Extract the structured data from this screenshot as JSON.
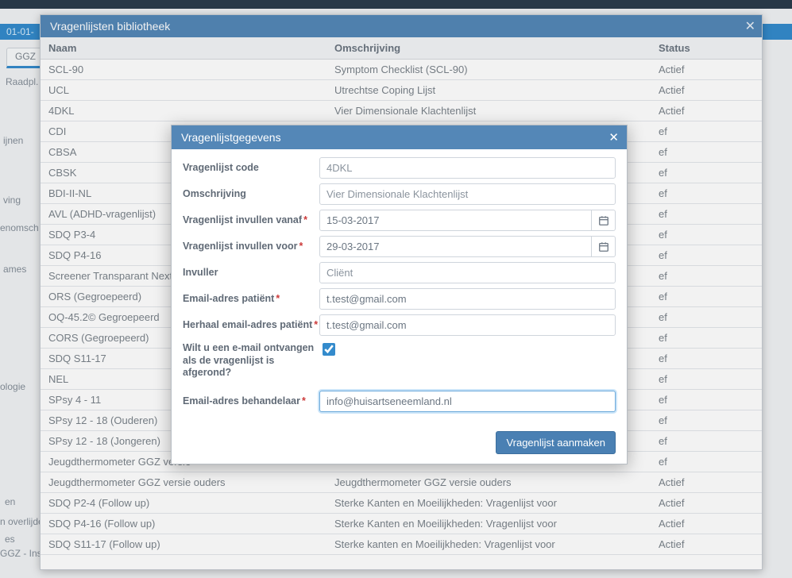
{
  "bg": {
    "date": "01-01-",
    "tab": "GGZ",
    "raadpl": "Raadpl. h",
    "frag1": "ijnen",
    "frag2": "ving",
    "frag3": "enomsch",
    "frag4": "ames",
    "frag5": "ologie",
    "frag6": "en",
    "frag7": "n overlijde",
    "frag8": "es",
    "frag9": "GGZ - Ins"
  },
  "library": {
    "title": "Vragenlijsten bibliotheek",
    "cols": {
      "name": "Naam",
      "desc": "Omschrijving",
      "status": "Status"
    },
    "rows": [
      {
        "name": "SCL-90",
        "desc": "Symptom Checklist (SCL-90)",
        "status": "Actief"
      },
      {
        "name": "UCL",
        "desc": "Utrechtse Coping Lijst",
        "status": "Actief"
      },
      {
        "name": "4DKL",
        "desc": "Vier Dimensionale Klachtenlijst",
        "status": "Actief"
      },
      {
        "name": "CDI",
        "desc": "",
        "status": "ef"
      },
      {
        "name": "CBSA",
        "desc": "",
        "status": "ef"
      },
      {
        "name": "CBSK",
        "desc": "",
        "status": "ef"
      },
      {
        "name": "BDI-II-NL",
        "desc": "",
        "status": "ef"
      },
      {
        "name": "AVL (ADHD-vragenlijst)",
        "desc": "",
        "status": "ef"
      },
      {
        "name": "SDQ P3-4",
        "desc": "",
        "status": "ef"
      },
      {
        "name": "SDQ P4-16",
        "desc": "",
        "status": "ef"
      },
      {
        "name": "Screener Transparant Next",
        "desc": "",
        "status": "ef"
      },
      {
        "name": "ORS (Gegroepeerd)",
        "desc": "",
        "status": "ef"
      },
      {
        "name": "OQ-45.2© Gegroepeerd",
        "desc": "",
        "status": "ef"
      },
      {
        "name": "CORS (Gegroepeerd)",
        "desc": "",
        "status": "ef"
      },
      {
        "name": "SDQ S11-17",
        "desc": "",
        "status": "ef"
      },
      {
        "name": "NEL",
        "desc": "",
        "status": "ef"
      },
      {
        "name": "SPsy 4 - 11",
        "desc": "",
        "status": "ef"
      },
      {
        "name": "SPsy 12 - 18 (Ouderen)",
        "desc": "",
        "status": "ef"
      },
      {
        "name": "SPsy 12 - 18 (Jongeren)",
        "desc": "",
        "status": "ef"
      },
      {
        "name": "Jeugdthermometer GGZ versie",
        "desc": "",
        "status": "ef"
      },
      {
        "name": "Jeugdthermometer GGZ versie ouders",
        "desc": "Jeugdthermometer GGZ versie ouders",
        "status": "Actief"
      },
      {
        "name": "SDQ P2-4 (Follow up)",
        "desc": "Sterke Kanten en Moeilijkheden: Vragenlijst voor",
        "status": "Actief"
      },
      {
        "name": "SDQ P4-16 (Follow up)",
        "desc": "Sterke Kanten en Moeilijkheden: Vragenlijst voor",
        "status": "Actief"
      },
      {
        "name": "SDQ S11-17 (Follow up)",
        "desc": "Sterke kanten en Moeilijkheden: Vragenlijst voor",
        "status": "Actief"
      }
    ]
  },
  "form": {
    "title": "Vragenlijstgegevens",
    "labels": {
      "code": "Vragenlijst code",
      "desc": "Omschrijving",
      "from": "Vragenlijst invullen vanaf",
      "to": "Vragenlijst invullen voor",
      "filler": "Invuller",
      "email": "Email-adres patiënt",
      "email_repeat": "Herhaal email-adres patiënt",
      "notify": "Wilt u een e-mail ontvangen als de vragenlijst is afgerond?",
      "email_handler": "Email-adres behandelaar"
    },
    "values": {
      "code": "4DKL",
      "desc": "Vier Dimensionale Klachtenlijst",
      "from": "15-03-2017",
      "to": "29-03-2017",
      "filler": "Cliënt",
      "email": "t.test@gmail.com",
      "email_repeat": "t.test@gmail.com",
      "notify": true,
      "email_handler": "info@huisartseneemland.nl"
    },
    "submit": "Vragenlijst aanmaken"
  }
}
